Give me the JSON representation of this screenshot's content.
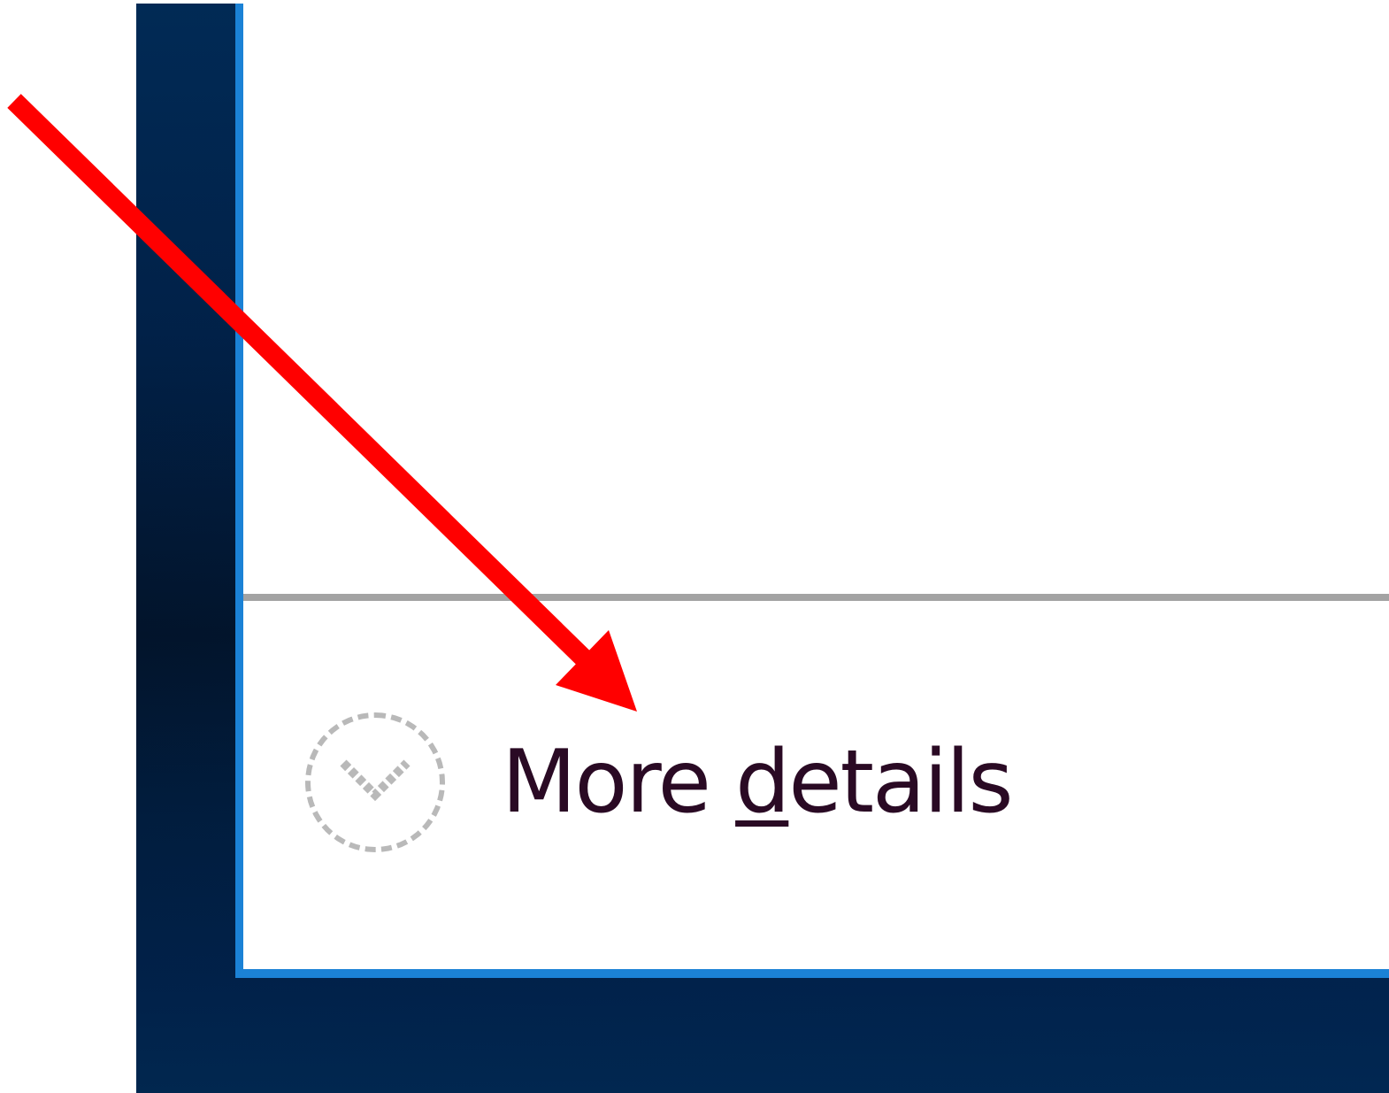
{
  "dialog": {
    "footer": {
      "expand_icon": "chevron-down-circle-icon",
      "label_prefix": "More ",
      "label_access_key": "d",
      "label_suffix": "etails"
    }
  },
  "annotation": {
    "arrow_icon": "red-pointer-arrow",
    "color": "#ff0000"
  },
  "colors": {
    "accent_border": "#1b82d6",
    "divider": "#a3a3a3",
    "desktop": "#012148"
  }
}
